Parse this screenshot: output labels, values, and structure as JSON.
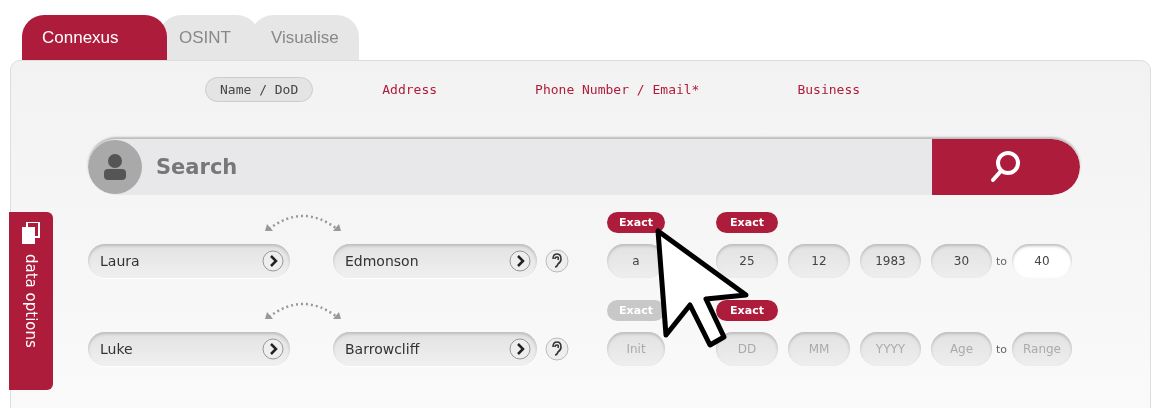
{
  "tabs": [
    {
      "label": "Connexus",
      "selected": true
    },
    {
      "label": "OSINT",
      "selected": false
    },
    {
      "label": "Visualise",
      "selected": false
    }
  ],
  "search_types": [
    {
      "label": "Name / DoD",
      "selected": true
    },
    {
      "label": "Address",
      "selected": false
    },
    {
      "label": "Phone Number / Email*",
      "selected": false
    },
    {
      "label": "Business",
      "selected": false
    }
  ],
  "search": {
    "placeholder": "Search"
  },
  "side_tab": {
    "label": "data options"
  },
  "rows": [
    {
      "first_name": {
        "value": "Laura"
      },
      "surname": {
        "value": "Edmonson"
      },
      "initial_exact": {
        "label": "Exact",
        "on": true
      },
      "initial": {
        "value": "a"
      },
      "dob_exact": {
        "label": "Exact",
        "on": true
      },
      "day": {
        "value": "25"
      },
      "month": {
        "value": "12"
      },
      "year": {
        "value": "1983"
      },
      "age_from": {
        "value": "30"
      },
      "to": "to",
      "age_to": {
        "value": "40",
        "focused": true
      }
    },
    {
      "first_name": {
        "value": "Luke"
      },
      "surname": {
        "value": "Barrowcliff"
      },
      "initial_exact": {
        "label": "Exact",
        "on": false
      },
      "initial": {
        "placeholder": "Init"
      },
      "dob_exact": {
        "label": "Exact",
        "on": true
      },
      "day": {
        "placeholder": "DD"
      },
      "month": {
        "placeholder": "MM"
      },
      "year": {
        "placeholder": "YYYY"
      },
      "age_from": {
        "placeholder": "Age"
      },
      "to": "to",
      "age_to": {
        "placeholder": "Range",
        "focused": false
      }
    }
  ]
}
